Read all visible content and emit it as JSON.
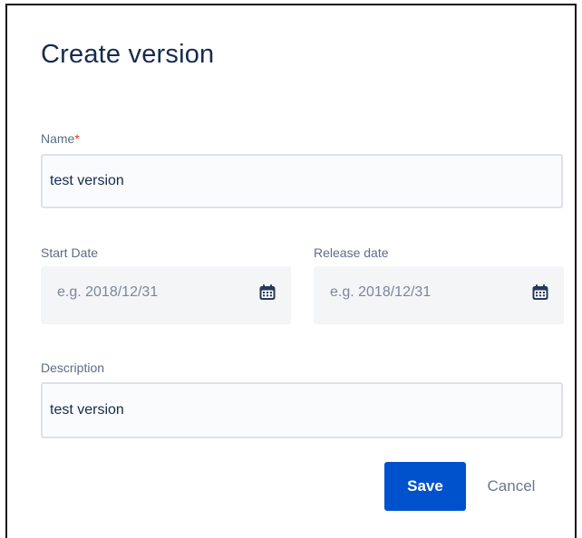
{
  "dialog": {
    "title": "Create version"
  },
  "fields": {
    "name": {
      "label": "Name",
      "required_marker": "*",
      "value": "test version"
    },
    "start_date": {
      "label": "Start Date",
      "placeholder": "e.g. 2018/12/31"
    },
    "release_date": {
      "label": "Release date",
      "placeholder": "e.g. 2018/12/31"
    },
    "description": {
      "label": "Description",
      "value": "test version"
    }
  },
  "actions": {
    "save_label": "Save",
    "cancel_label": "Cancel"
  },
  "icons": {
    "start_date_icon": "calendar-icon",
    "release_date_icon": "calendar-icon"
  },
  "colors": {
    "primary_button": "#0052cc",
    "required_marker": "#de350b",
    "title_text": "#172b4d",
    "label_text": "#5e6c84",
    "field_background": "#f4f5f7"
  }
}
